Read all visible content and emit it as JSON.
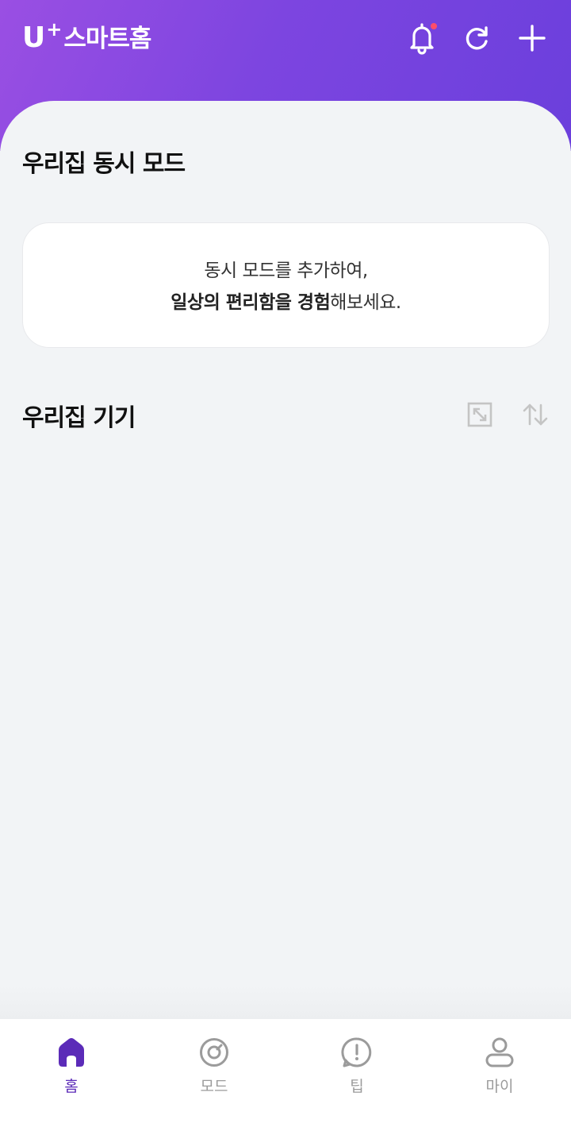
{
  "header": {
    "logo_u": "U",
    "logo_plus": "+",
    "logo_name": "스마트홈",
    "notification_dot_color": "#ff4d6a",
    "icons": [
      "bell-icon",
      "refresh-icon",
      "plus-icon"
    ]
  },
  "mode_section": {
    "title": "우리집 동시 모드",
    "empty_line1": "동시 모드를 추가하여,",
    "empty_line2_bold": "일상의 편리함을 경험",
    "empty_line2_rest": "해보세요."
  },
  "device_section": {
    "title": "우리집 기기",
    "icons": [
      "expand-icon",
      "sort-icon"
    ]
  },
  "tabbar": {
    "tabs": [
      {
        "label": "홈",
        "icon": "home-icon",
        "active": true
      },
      {
        "label": "모드",
        "icon": "mode-icon",
        "active": false
      },
      {
        "label": "팁",
        "icon": "tip-icon",
        "active": false
      },
      {
        "label": "마이",
        "icon": "profile-icon",
        "active": false
      }
    ]
  },
  "colors": {
    "brand": "#7d45e0",
    "active_tab": "#5b2bb8",
    "inactive": "#9b9b9b"
  }
}
